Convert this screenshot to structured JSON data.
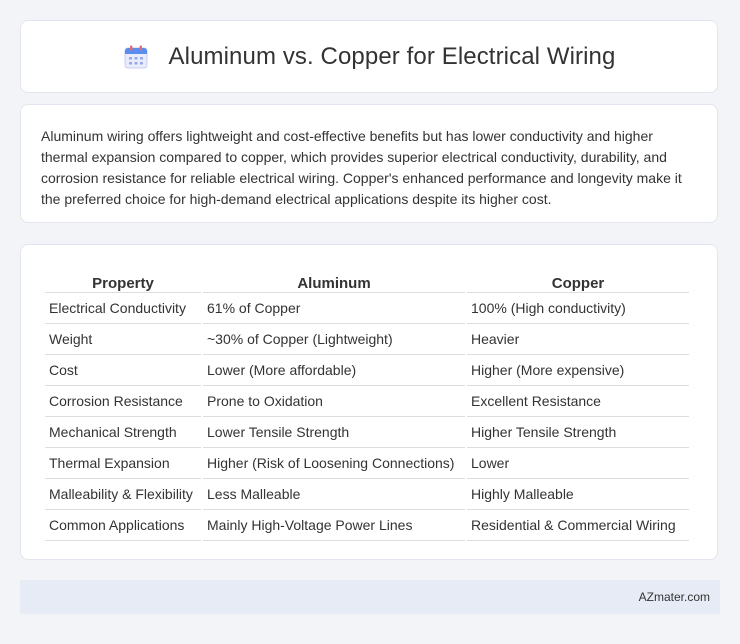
{
  "header": {
    "title": "Aluminum vs. Copper for Electrical Wiring",
    "icon": "calendar-icon"
  },
  "summary": {
    "text": "Aluminum wiring offers lightweight and cost-effective benefits but has lower conductivity and higher thermal expansion compared to copper, which provides superior electrical conductivity, durability, and corrosion resistance for reliable electrical wiring. Copper's enhanced performance and longevity make it the preferred choice for high-demand electrical applications despite its higher cost."
  },
  "table": {
    "headers": [
      "Property",
      "Aluminum",
      "Copper"
    ],
    "rows": [
      [
        "Electrical Conductivity",
        "61% of Copper",
        "100% (High conductivity)"
      ],
      [
        "Weight",
        "~30% of Copper (Lightweight)",
        "Heavier"
      ],
      [
        "Cost",
        "Lower (More affordable)",
        "Higher (More expensive)"
      ],
      [
        "Corrosion Resistance",
        "Prone to Oxidation",
        "Excellent Resistance"
      ],
      [
        "Mechanical Strength",
        "Lower Tensile Strength",
        "Higher Tensile Strength"
      ],
      [
        "Thermal Expansion",
        "Higher (Risk of Loosening Connections)",
        "Lower"
      ],
      [
        "Malleability & Flexibility",
        "Less Malleable",
        "Highly Malleable"
      ],
      [
        "Common Applications",
        "Mainly High-Voltage Power Lines",
        "Residential & Commercial Wiring"
      ]
    ]
  },
  "footer": {
    "text": "AZmater.com"
  }
}
